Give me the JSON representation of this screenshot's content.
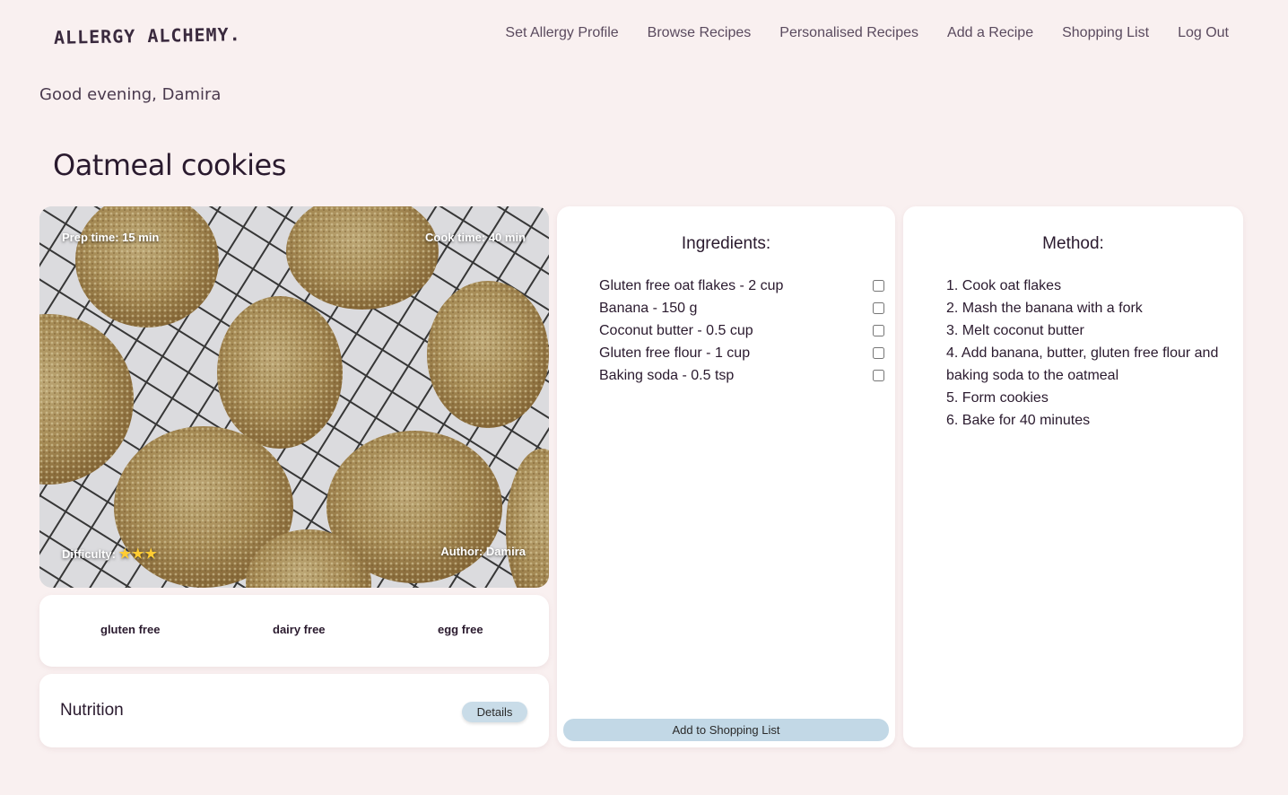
{
  "header": {
    "logo": "ALLERGY ALCHEMY.",
    "nav": [
      "Set Allergy Profile",
      "Browse Recipes",
      "Personalised Recipes",
      "Add a Recipe",
      "Shopping List",
      "Log Out"
    ]
  },
  "greeting": "Good evening, Damira",
  "recipe": {
    "title": "Oatmeal cookies",
    "prep_time": "Prep time: 15 min",
    "cook_time": "Cook time: 40 min",
    "difficulty_label": "Difficulty:",
    "difficulty_stars": "★★★",
    "difficulty_level": 3,
    "author": "Author: Damira",
    "image_icon": "cookies-photo"
  },
  "tags": [
    "gluten free",
    "dairy free",
    "egg free"
  ],
  "nutrition": {
    "title": "Nutrition",
    "details_label": "Details"
  },
  "ingredients": {
    "heading": "Ingredients:",
    "items": [
      "Gluten free oat flakes - 2 cup",
      "Banana - 150 g",
      "Coconut butter - 0.5 cup",
      "Gluten free flour - 1 cup",
      "Baking soda - 0.5 tsp"
    ],
    "button_label": "Add to Shopping List"
  },
  "method": {
    "heading": "Method:",
    "steps": [
      "1. Cook oat flakes",
      "2. Mash the banana with a fork",
      "3. Melt coconut butter",
      "4. Add banana, butter, gluten free flour and baking soda to the oatmeal",
      "5. Form cookies",
      "6. Bake for 40 minutes"
    ]
  },
  "colors": {
    "background": "#f9f0f0",
    "button": "#c2d8e6",
    "star": "#ffcc33"
  }
}
